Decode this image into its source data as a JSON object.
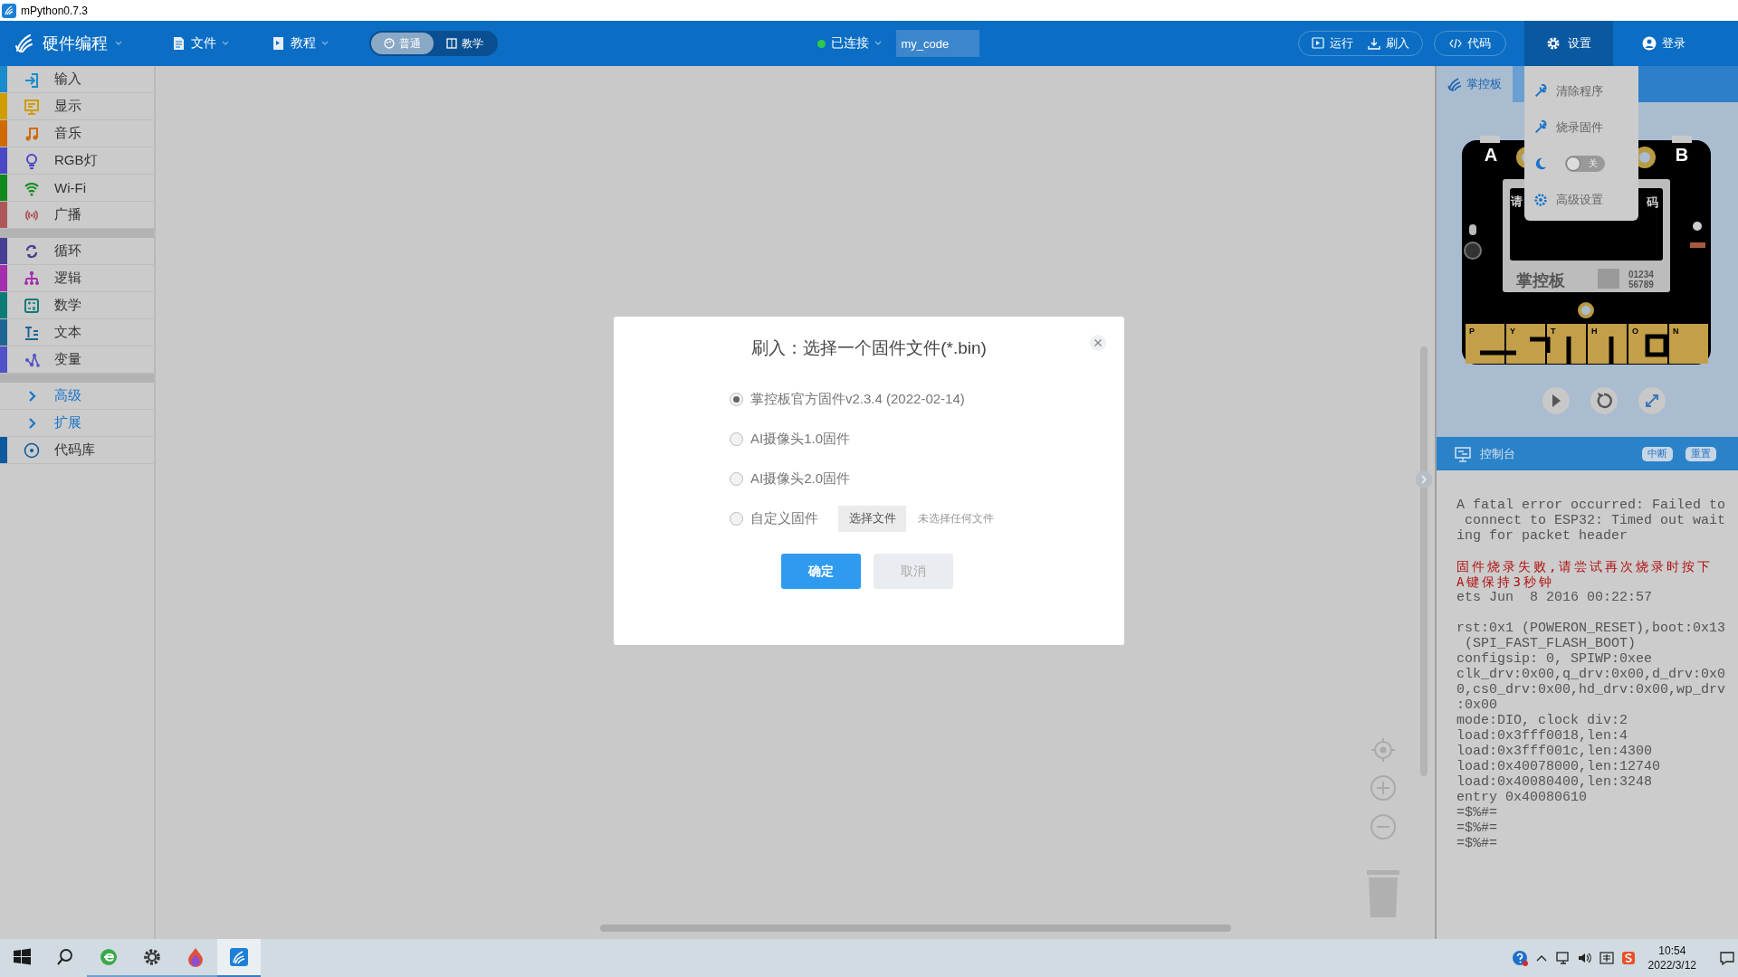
{
  "window": {
    "title": "mPython0.7.3"
  },
  "toolbar": {
    "app_name": "硬件编程",
    "menus": [
      {
        "kind": "file",
        "label": "文件"
      },
      {
        "kind": "tutorial",
        "label": "教程"
      }
    ],
    "mode_tabs": [
      {
        "label": "普通",
        "selected": true
      },
      {
        "label": "教学",
        "selected": false
      }
    ],
    "connection": {
      "label": "已连接",
      "connected": true
    },
    "project_name": "my_code",
    "actions": [
      {
        "kind": "run",
        "label": "运行"
      },
      {
        "kind": "flash",
        "label": "刷入"
      },
      {
        "kind": "code",
        "label": "代码"
      }
    ],
    "settings": {
      "label": "设置",
      "open": true
    },
    "login": {
      "label": "登录"
    }
  },
  "sidebar": {
    "groups": [
      {
        "items": [
          {
            "kind": "category",
            "label": "输入",
            "color": "#1a8ccc"
          },
          {
            "kind": "category",
            "label": "显示",
            "color": "#cf9d00"
          },
          {
            "kind": "category",
            "label": "音乐",
            "color": "#cf6a00"
          },
          {
            "kind": "category",
            "label": "RGB灯",
            "color": "#4a48c4"
          },
          {
            "kind": "category",
            "label": "Wi-Fi",
            "color": "#108a1c"
          },
          {
            "kind": "category",
            "label": "广播",
            "color": "#ad5858"
          }
        ]
      },
      {
        "items": [
          {
            "kind": "category",
            "label": "循环",
            "color": "#463f94"
          },
          {
            "kind": "category",
            "label": "逻辑",
            "color": "#a52eae"
          },
          {
            "kind": "category",
            "label": "数学",
            "color": "#0e7a76"
          },
          {
            "kind": "category",
            "label": "文本",
            "color": "#1e6492"
          },
          {
            "kind": "category",
            "label": "变量",
            "color": "#5252c8"
          }
        ]
      },
      {
        "items": [
          {
            "kind": "expander",
            "label": "高级"
          },
          {
            "kind": "expander",
            "label": "扩展"
          },
          {
            "kind": "category",
            "label": "代码库",
            "color": "#0d5a9e"
          }
        ]
      }
    ]
  },
  "settings_menu": {
    "items": [
      {
        "kind": "tool",
        "label": "清除程序"
      },
      {
        "kind": "tool",
        "label": "烧录固件"
      },
      {
        "kind": "theme",
        "label": "关",
        "on": false
      },
      {
        "kind": "settings",
        "label": "高级设置"
      }
    ]
  },
  "simulator": {
    "tabs": [
      {
        "label": "掌控板",
        "selected": true
      }
    ],
    "board": {
      "buttons": [
        "A",
        "B"
      ],
      "screen_text": [
        "请",
        "码"
      ],
      "brand": "掌控板",
      "serial": [
        "01234",
        "56789"
      ],
      "pins": [
        "P",
        "Y",
        "T",
        "H",
        "O",
        "N"
      ]
    }
  },
  "console": {
    "title": "控制台",
    "buttons": [
      "中断",
      "重置"
    ],
    "blocks": [
      {
        "kind": "output",
        "lines": [
          "A fatal error occurred: Failed to",
          " connect to ESP32: Timed out wait",
          "ing for packet header"
        ]
      },
      {
        "kind": "error",
        "lines": [
          "固件烧录失败,请尝试再次烧录时按下",
          "A键保持3秒钟"
        ]
      },
      {
        "kind": "output",
        "lines": [
          "ets Jun  8 2016 00:22:57"
        ]
      },
      {
        "kind": "output",
        "lines": [
          "rst:0x1 (POWERON_RESET),boot:0x13",
          " (SPI_FAST_FLASH_BOOT)",
          "configsip: 0, SPIWP:0xee",
          "clk_drv:0x00,q_drv:0x00,d_drv:0x0",
          "0,cs0_drv:0x00,hd_drv:0x00,wp_drv",
          ":0x00",
          "mode:DIO, clock div:2",
          "load:0x3fff0018,len:4",
          "load:0x3fff001c,len:4300",
          "load:0x40078000,len:12740",
          "load:0x40080400,len:3248",
          "entry 0x40080610",
          "=$%#=",
          "=$%#=",
          "=$%#="
        ]
      }
    ]
  },
  "dialog": {
    "title": "刷入：选择一个固件文件(*.bin)",
    "options": [
      {
        "kind": "preset",
        "label": "掌控板官方固件v2.3.4 (2022-02-14)",
        "selected": true
      },
      {
        "kind": "preset",
        "label": "AI摄像头1.0固件",
        "selected": false
      },
      {
        "kind": "preset",
        "label": "AI摄像头2.0固件",
        "selected": false
      },
      {
        "kind": "file",
        "label": "自定义固件",
        "selected": false,
        "file_button": "选择文件",
        "file_status": "未选择任何文件"
      }
    ],
    "buttons": [
      {
        "kind": "primary",
        "label": "确定"
      },
      {
        "kind": "secondary",
        "label": "取消"
      }
    ]
  },
  "taskbar": {
    "apps": [
      {
        "kind": "start",
        "running": false,
        "selected": false
      },
      {
        "kind": "search",
        "running": false,
        "selected": false
      },
      {
        "kind": "browser",
        "running": true,
        "selected": false
      },
      {
        "kind": "settings",
        "running": true,
        "selected": false
      },
      {
        "kind": "paint",
        "running": true,
        "selected": false
      },
      {
        "kind": "mpython",
        "running": true,
        "selected": true
      }
    ],
    "clock": {
      "time": "10:54",
      "date": "2022/3/12"
    }
  }
}
